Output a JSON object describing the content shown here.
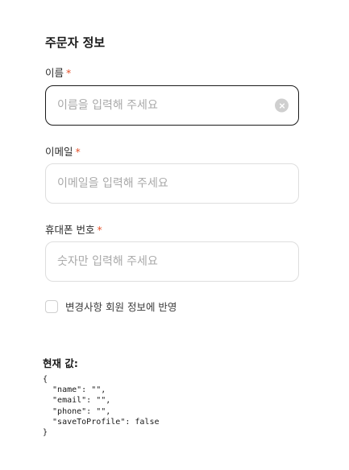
{
  "form": {
    "title": "주문자 정보",
    "required_mark": "*",
    "fields": [
      {
        "label": "이름",
        "value": "",
        "placeholder": "이름을 입력해 주세요"
      },
      {
        "label": "이메일",
        "value": "",
        "placeholder": "이메일을 입력해 주세요"
      },
      {
        "label": "휴대폰 번호",
        "value": "",
        "placeholder": "숫자만 입력해 주세요"
      }
    ],
    "checkbox": {
      "label": "변경사항 회원 정보에 반영",
      "checked": false
    }
  },
  "debug": {
    "title": "현재 값:",
    "json_text": "{\n  \"name\": \"\",\n  \"email\": \"\",\n  \"phone\": \"\",\n  \"saveToProfile\": false\n}"
  },
  "colors": {
    "required": "#e5532d",
    "focus_border": "#1a1a1a",
    "border": "#dedede",
    "placeholder": "#a9a9a9"
  },
  "icons": {
    "clear": "close-circle-icon"
  }
}
